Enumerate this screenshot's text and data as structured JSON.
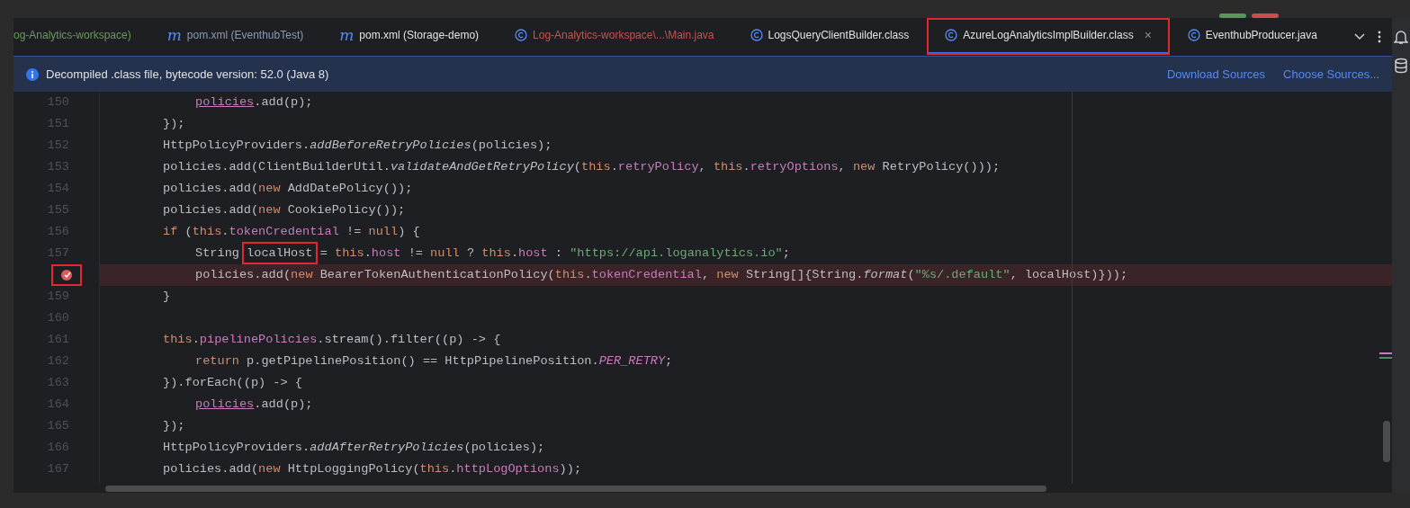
{
  "tabs": [
    {
      "label": "og-Analytics-workspace)",
      "kind": "plain",
      "color": "#6a9a5a",
      "selected": false,
      "boxed": false
    },
    {
      "label": "pom.xml (EventhubTest)",
      "kind": "maven",
      "glyph": "m",
      "color": "#8a9bb2",
      "selected": false,
      "boxed": false
    },
    {
      "label": "pom.xml (Storage-demo)",
      "kind": "maven",
      "glyph": "m",
      "color": "#dfe1e5",
      "selected": false,
      "boxed": false
    },
    {
      "label": "Log-Analytics-workspace\\...\\Main.java",
      "kind": "class",
      "color": "#c75450",
      "selected": false,
      "boxed": false
    },
    {
      "label": "LogsQueryClientBuilder.class",
      "kind": "class",
      "color": "#dfe1e5",
      "selected": false,
      "boxed": false
    },
    {
      "label": "AzureLogAnalyticsImplBuilder.class",
      "kind": "class",
      "color": "#dfe1e5",
      "selected": true,
      "boxed": true,
      "close": "×"
    },
    {
      "label": "EventhubProducer.java",
      "kind": "class",
      "color": "#dfe1e5",
      "selected": false,
      "boxed": false
    }
  ],
  "banner": {
    "text": "Decompiled .class file, bytecode version: 52.0 (Java 8)",
    "links": [
      "Download Sources",
      "Choose Sources..."
    ]
  },
  "lines": [
    {
      "number": "150",
      "kind": "nested",
      "tokens": [
        {
          "text": "policies",
          "kind": "captured"
        },
        {
          "text": ".add(p);",
          "kind": "plain"
        }
      ]
    },
    {
      "number": "151",
      "kind": "body",
      "tokens": [
        {
          "text": "});",
          "kind": "plain"
        }
      ]
    },
    {
      "number": "152",
      "kind": "body",
      "tokens": [
        {
          "text": "HttpPolicyProviders.",
          "kind": "plain"
        },
        {
          "text": "addBeforeRetryPolicies",
          "kind": "italic"
        },
        {
          "text": "(policies);",
          "kind": "plain"
        }
      ]
    },
    {
      "number": "153",
      "kind": "body",
      "tokens": [
        {
          "text": "policies.add(ClientBuilderUtil.",
          "kind": "plain"
        },
        {
          "text": "validateAndGetRetryPolicy",
          "kind": "italic"
        },
        {
          "text": "(",
          "kind": "plain"
        },
        {
          "text": "this",
          "kind": "keyword"
        },
        {
          "text": ".",
          "kind": "plain"
        },
        {
          "text": "retryPolicy",
          "kind": "field"
        },
        {
          "text": ", ",
          "kind": "plain"
        },
        {
          "text": "this",
          "kind": "keyword"
        },
        {
          "text": ".",
          "kind": "plain"
        },
        {
          "text": "retryOptions",
          "kind": "field"
        },
        {
          "text": ", ",
          "kind": "plain"
        },
        {
          "text": "new",
          "kind": "keyword"
        },
        {
          "text": " RetryPolicy()));",
          "kind": "plain"
        }
      ]
    },
    {
      "number": "154",
      "kind": "body",
      "tokens": [
        {
          "text": "policies.add(",
          "kind": "plain"
        },
        {
          "text": "new",
          "kind": "keyword"
        },
        {
          "text": " AddDatePolicy());",
          "kind": "plain"
        }
      ]
    },
    {
      "number": "155",
      "kind": "body",
      "tokens": [
        {
          "text": "policies.add(",
          "kind": "plain"
        },
        {
          "text": "new",
          "kind": "keyword"
        },
        {
          "text": " CookiePolicy());",
          "kind": "plain"
        }
      ]
    },
    {
      "number": "156",
      "kind": "body",
      "tokens": [
        {
          "text": "if",
          "kind": "keyword"
        },
        {
          "text": " (",
          "kind": "plain"
        },
        {
          "text": "this",
          "kind": "keyword"
        },
        {
          "text": ".",
          "kind": "plain"
        },
        {
          "text": "tokenCredential",
          "kind": "field"
        },
        {
          "text": " != ",
          "kind": "plain"
        },
        {
          "text": "null",
          "kind": "keyword"
        },
        {
          "text": ") {",
          "kind": "plain"
        }
      ]
    },
    {
      "number": "157",
      "kind": "nested",
      "tokens": [
        {
          "text": "String ",
          "kind": "plain"
        },
        {
          "text": "localHost",
          "kind": "plain",
          "boxed": true
        },
        {
          "text": " = ",
          "kind": "plain"
        },
        {
          "text": "this",
          "kind": "keyword"
        },
        {
          "text": ".",
          "kind": "plain"
        },
        {
          "text": "host",
          "kind": "field"
        },
        {
          "text": " != ",
          "kind": "plain"
        },
        {
          "text": "null",
          "kind": "keyword"
        },
        {
          "text": " ? ",
          "kind": "plain"
        },
        {
          "text": "this",
          "kind": "keyword"
        },
        {
          "text": ".",
          "kind": "plain"
        },
        {
          "text": "host",
          "kind": "field"
        },
        {
          "text": " : ",
          "kind": "plain"
        },
        {
          "text": "\"https://api.loganalytics.io\"",
          "kind": "string"
        },
        {
          "text": ";",
          "kind": "plain"
        }
      ]
    },
    {
      "kind": "nested",
      "breakpoint": true,
      "tokens": [
        {
          "text": "policies.add(",
          "kind": "plain"
        },
        {
          "text": "new",
          "kind": "keyword"
        },
        {
          "text": " BearerTokenAuthenticationPolicy(",
          "kind": "plain"
        },
        {
          "text": "this",
          "kind": "keyword"
        },
        {
          "text": ".",
          "kind": "plain"
        },
        {
          "text": "tokenCredential",
          "kind": "field"
        },
        {
          "text": ", ",
          "kind": "plain"
        },
        {
          "text": "new",
          "kind": "keyword"
        },
        {
          "text": " String[]{String.",
          "kind": "plain"
        },
        {
          "text": "format",
          "kind": "italic"
        },
        {
          "text": "(",
          "kind": "plain"
        },
        {
          "text": "\"%s/.default\"",
          "kind": "string"
        },
        {
          "text": ", localHost)}));",
          "kind": "plain"
        }
      ]
    },
    {
      "number": "159",
      "kind": "body",
      "tokens": [
        {
          "text": "}",
          "kind": "plain"
        }
      ]
    },
    {
      "number": "160",
      "kind": "body"
    },
    {
      "number": "161",
      "kind": "body",
      "tokens": [
        {
          "text": "this",
          "kind": "keyword"
        },
        {
          "text": ".",
          "kind": "plain"
        },
        {
          "text": "pipelinePolicies",
          "kind": "field"
        },
        {
          "text": ".stream().filter((p) -> {",
          "kind": "plain"
        }
      ]
    },
    {
      "number": "162",
      "kind": "nested",
      "tokens": [
        {
          "text": "return",
          "kind": "keyword"
        },
        {
          "text": " p.getPipelinePosition() == HttpPipelinePosition.",
          "kind": "plain"
        },
        {
          "text": "PER_RETRY",
          "kind": "constant"
        },
        {
          "text": ";",
          "kind": "plain"
        }
      ]
    },
    {
      "number": "163",
      "kind": "body",
      "tokens": [
        {
          "text": "}).forEach((p) -> {",
          "kind": "plain"
        }
      ]
    },
    {
      "number": "164",
      "kind": "nested",
      "tokens": [
        {
          "text": "policies",
          "kind": "captured"
        },
        {
          "text": ".add(p);",
          "kind": "plain"
        }
      ]
    },
    {
      "number": "165",
      "kind": "body",
      "tokens": [
        {
          "text": "});",
          "kind": "plain"
        }
      ]
    },
    {
      "number": "166",
      "kind": "body",
      "tokens": [
        {
          "text": "HttpPolicyProviders.",
          "kind": "plain"
        },
        {
          "text": "addAfterRetryPolicies",
          "kind": "italic"
        },
        {
          "text": "(policies);",
          "kind": "plain"
        }
      ]
    },
    {
      "number": "167",
      "kind": "body",
      "tokens": [
        {
          "text": "policies.add(",
          "kind": "plain"
        },
        {
          "text": "new",
          "kind": "keyword"
        },
        {
          "text": " HttpLoggingPolicy(",
          "kind": "plain"
        },
        {
          "text": "this",
          "kind": "keyword"
        },
        {
          "text": ".",
          "kind": "plain"
        },
        {
          "text": "httpLogOptions",
          "kind": "field"
        },
        {
          "text": "));",
          "kind": "plain"
        }
      ]
    }
  ]
}
